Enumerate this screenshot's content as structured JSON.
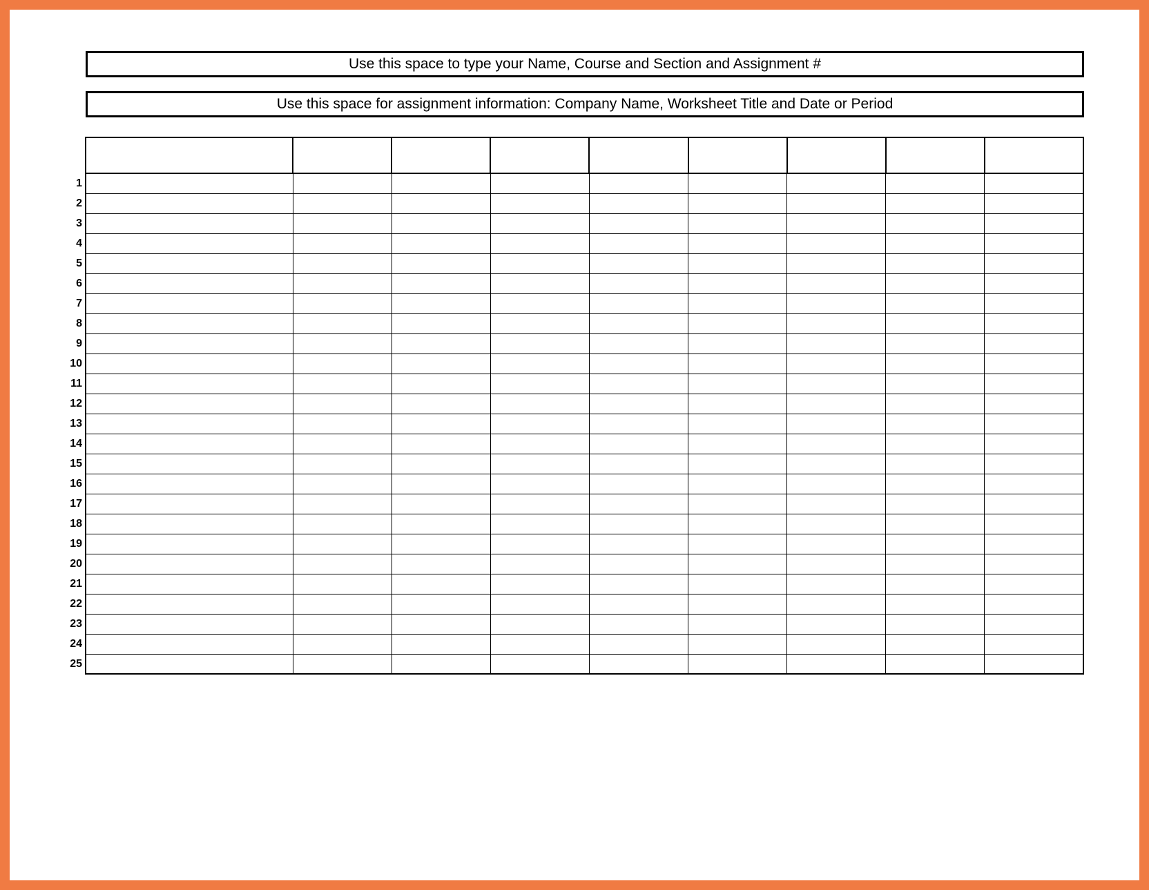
{
  "header": {
    "title": "Use this space to type your Name, Course and Section and Assignment #"
  },
  "subheader": {
    "title": "Use this space for assignment information: Company Name, Worksheet Title and Date or Period"
  },
  "table": {
    "row_numbers": [
      "1",
      "2",
      "3",
      "4",
      "5",
      "6",
      "7",
      "8",
      "9",
      "10",
      "11",
      "12",
      "13",
      "14",
      "15",
      "16",
      "17",
      "18",
      "19",
      "20",
      "21",
      "22",
      "23",
      "24",
      "25"
    ],
    "num_data_columns": 9,
    "header_cells": [
      "",
      "",
      "",
      "",
      "",
      "",
      "",
      "",
      ""
    ],
    "rows": [
      [
        "",
        "",
        "",
        "",
        "",
        "",
        "",
        "",
        ""
      ],
      [
        "",
        "",
        "",
        "",
        "",
        "",
        "",
        "",
        ""
      ],
      [
        "",
        "",
        "",
        "",
        "",
        "",
        "",
        "",
        ""
      ],
      [
        "",
        "",
        "",
        "",
        "",
        "",
        "",
        "",
        ""
      ],
      [
        "",
        "",
        "",
        "",
        "",
        "",
        "",
        "",
        ""
      ],
      [
        "",
        "",
        "",
        "",
        "",
        "",
        "",
        "",
        ""
      ],
      [
        "",
        "",
        "",
        "",
        "",
        "",
        "",
        "",
        ""
      ],
      [
        "",
        "",
        "",
        "",
        "",
        "",
        "",
        "",
        ""
      ],
      [
        "",
        "",
        "",
        "",
        "",
        "",
        "",
        "",
        ""
      ],
      [
        "",
        "",
        "",
        "",
        "",
        "",
        "",
        "",
        ""
      ],
      [
        "",
        "",
        "",
        "",
        "",
        "",
        "",
        "",
        ""
      ],
      [
        "",
        "",
        "",
        "",
        "",
        "",
        "",
        "",
        ""
      ],
      [
        "",
        "",
        "",
        "",
        "",
        "",
        "",
        "",
        ""
      ],
      [
        "",
        "",
        "",
        "",
        "",
        "",
        "",
        "",
        ""
      ],
      [
        "",
        "",
        "",
        "",
        "",
        "",
        "",
        "",
        ""
      ],
      [
        "",
        "",
        "",
        "",
        "",
        "",
        "",
        "",
        ""
      ],
      [
        "",
        "",
        "",
        "",
        "",
        "",
        "",
        "",
        ""
      ],
      [
        "",
        "",
        "",
        "",
        "",
        "",
        "",
        "",
        ""
      ],
      [
        "",
        "",
        "",
        "",
        "",
        "",
        "",
        "",
        ""
      ],
      [
        "",
        "",
        "",
        "",
        "",
        "",
        "",
        "",
        ""
      ],
      [
        "",
        "",
        "",
        "",
        "",
        "",
        "",
        "",
        ""
      ],
      [
        "",
        "",
        "",
        "",
        "",
        "",
        "",
        "",
        ""
      ],
      [
        "",
        "",
        "",
        "",
        "",
        "",
        "",
        "",
        ""
      ],
      [
        "",
        "",
        "",
        "",
        "",
        "",
        "",
        "",
        ""
      ],
      [
        "",
        "",
        "",
        "",
        "",
        "",
        "",
        "",
        ""
      ]
    ]
  }
}
